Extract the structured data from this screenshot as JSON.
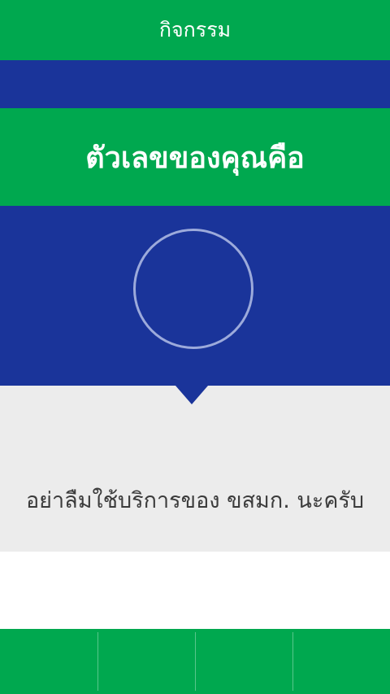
{
  "app_bar": {
    "title": "กิจกรรม"
  },
  "result": {
    "headline": "ตัวเลขของคุณคือ",
    "number": ""
  },
  "message": {
    "text": "อย่าลืมใช้บริการของ ขสมก. นะครับ"
  },
  "bottom_nav": {
    "tabs": [
      {
        "label": ""
      },
      {
        "label": ""
      },
      {
        "label": ""
      },
      {
        "label": ""
      }
    ]
  },
  "colors": {
    "green": "#00a84f",
    "blue": "#1a349a",
    "panel_gray": "#ececec",
    "text_dark": "#3b3b3b"
  }
}
